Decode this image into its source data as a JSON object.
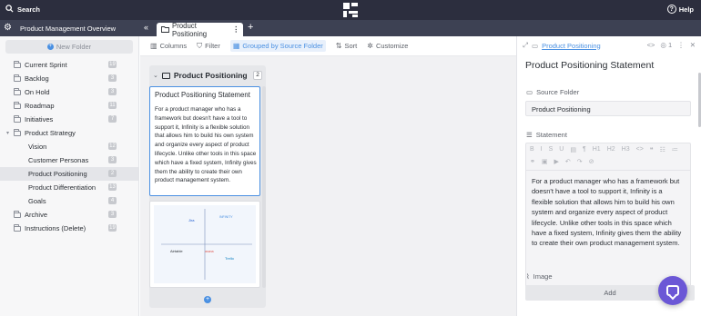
{
  "topbar": {
    "search_label": "Search",
    "help_label": "Help",
    "logo_icon": "app-logo-icon"
  },
  "workspace": {
    "name": "Product Management Overview",
    "tab_label": "Product Positioning"
  },
  "sidebar": {
    "new_folder_label": "New Folder",
    "items": [
      {
        "label": "Current Sprint",
        "count": "19",
        "level": 0
      },
      {
        "label": "Backlog",
        "count": "3",
        "level": 0
      },
      {
        "label": "On Hold",
        "count": "3",
        "level": 0
      },
      {
        "label": "Roadmap",
        "count": "11",
        "level": 0
      },
      {
        "label": "Initiatives",
        "count": "7",
        "level": 0
      },
      {
        "label": "Product Strategy",
        "count": "",
        "level": 0
      },
      {
        "label": "Vision",
        "count": "12",
        "level": 1
      },
      {
        "label": "Customer Personas",
        "count": "3",
        "level": 1
      },
      {
        "label": "Product Positioning",
        "count": "2",
        "level": 1
      },
      {
        "label": "Product Differentiation",
        "count": "13",
        "level": 1
      },
      {
        "label": "Goals",
        "count": "4",
        "level": 1
      },
      {
        "label": "Archive",
        "count": "3",
        "level": 0
      },
      {
        "label": "Instructions (Delete)",
        "count": "19",
        "level": 0
      }
    ]
  },
  "toolbar": {
    "columns_label": "Columns",
    "filter_label": "Filter",
    "group_label": "Grouped by Source Folder",
    "sort_label": "Sort",
    "customize_label": "Customize"
  },
  "board": {
    "column_title": "Product Positioning",
    "column_count": "2",
    "card_title": "Product Positioning Statement",
    "card_body": "For a product manager who has a framework but doesn't have a tool to support it, Infinity is a flexible solution that allows him to build his own system and organize every aspect of product lifecycle. Unlike other tools in this space which have a fixed system, Infinity gives them the ability to create their own product management system.",
    "chart_labels": [
      "Jira",
      "INFINITY",
      "Airtable",
      "asana",
      "Trello"
    ]
  },
  "panel": {
    "breadcrumb": "Product Positioning",
    "comment_count": "1",
    "title": "Product Positioning Statement",
    "source_folder_label": "Source Folder",
    "source_folder_value": "Product Positioning",
    "statement_label": "Statement",
    "statement_text": "For a product manager who has a framework but doesn't have a tool to support it, Infinity is a flexible solution that allows him to build his own system and organize every aspect of product lifecycle. Unlike other tools in this space which have a fixed system, Infinity gives them the ability to create their own product management system.",
    "image_label": "Image",
    "add_label": "Add"
  },
  "colors": {
    "accent": "#4a90e2",
    "topbar": "#2c2e3e",
    "fab": "#6b57d6"
  }
}
